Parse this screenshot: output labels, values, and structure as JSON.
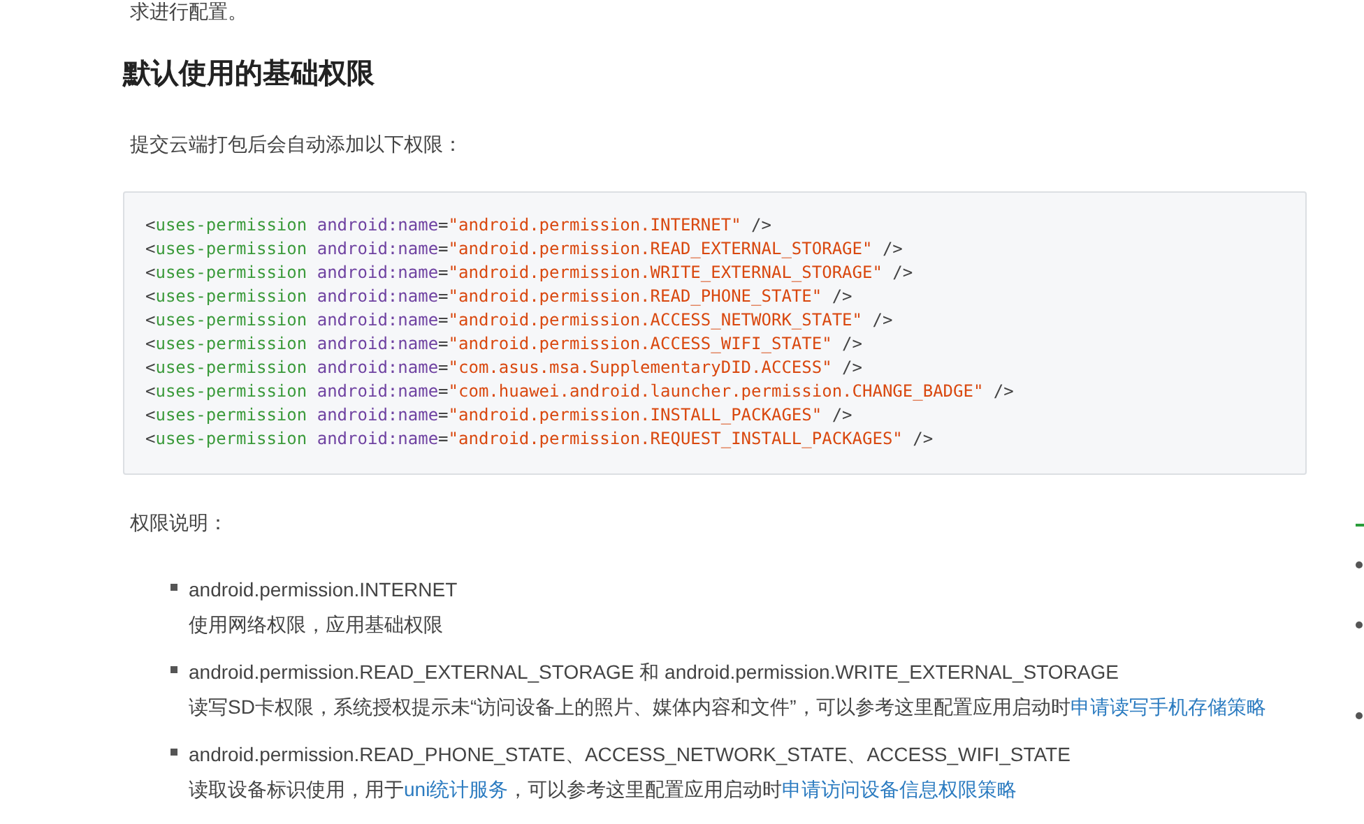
{
  "intro_cut": "求进行配置。",
  "heading": "默认使用的基础权限",
  "lead": "提交云端打包后会自动添加以下权限：",
  "code_lines": [
    {
      "open": "<",
      "tag": "uses-permission",
      "attr": "android:name",
      "eq": "=",
      "value": "\"android.permission.INTERNET\"",
      "close": "/>"
    },
    {
      "open": "<",
      "tag": "uses-permission",
      "attr": "android:name",
      "eq": "=",
      "value": "\"android.permission.READ_EXTERNAL_STORAGE\"",
      "close": "/>"
    },
    {
      "open": "<",
      "tag": "uses-permission",
      "attr": "android:name",
      "eq": "=",
      "value": "\"android.permission.WRITE_EXTERNAL_STORAGE\"",
      "close": "/>"
    },
    {
      "open": "<",
      "tag": "uses-permission",
      "attr": "android:name",
      "eq": "=",
      "value": "\"android.permission.READ_PHONE_STATE\"",
      "close": "/>"
    },
    {
      "open": "<",
      "tag": "uses-permission",
      "attr": "android:name",
      "eq": "=",
      "value": "\"android.permission.ACCESS_NETWORK_STATE\"",
      "close": "/>"
    },
    {
      "open": "<",
      "tag": "uses-permission",
      "attr": "android:name",
      "eq": "=",
      "value": "\"android.permission.ACCESS_WIFI_STATE\"",
      "close": "/>"
    },
    {
      "open": "<",
      "tag": "uses-permission",
      "attr": "android:name",
      "eq": "=",
      "value": "\"com.asus.msa.SupplementaryDID.ACCESS\"",
      "close": "/>"
    },
    {
      "open": "<",
      "tag": "uses-permission",
      "attr": "android:name",
      "eq": "=",
      "value": "\"com.huawei.android.launcher.permission.CHANGE_BADGE\"",
      "close": "/>"
    },
    {
      "open": "<",
      "tag": "uses-permission",
      "attr": "android:name",
      "eq": "=",
      "value": "\"android.permission.INSTALL_PACKAGES\"",
      "close": "/>"
    },
    {
      "open": "<",
      "tag": "uses-permission",
      "attr": "android:name",
      "eq": "=",
      "value": "\"android.permission.REQUEST_INSTALL_PACKAGES\"",
      "close": "/>"
    }
  ],
  "notes_label": "权限说明：",
  "permissions": [
    {
      "title": "android.permission.INTERNET",
      "description": [
        {
          "text": "使用网络权限，应用基础权限",
          "link": false
        }
      ]
    },
    {
      "title": "android.permission.READ_EXTERNAL_STORAGE 和 android.permission.WRITE_EXTERNAL_STORAGE",
      "description": [
        {
          "text": "读写SD卡权限，系统授权提示未“访问设备上的照片、媒体内容和文件”，可以参考这里配置应用启动时",
          "link": false
        },
        {
          "text": "申请读写手机存储策略",
          "link": true
        }
      ]
    },
    {
      "title": "android.permission.READ_PHONE_STATE、ACCESS_NETWORK_STATE、ACCESS_WIFI_STATE",
      "description": [
        {
          "text": "读取设备标识使用，用于",
          "link": false
        },
        {
          "text": "uni统计服务",
          "link": true
        },
        {
          "text": "，可以参考这里配置应用启动时",
          "link": false
        },
        {
          "text": "申请访问设备信息权限策略",
          "link": true
        }
      ]
    }
  ]
}
